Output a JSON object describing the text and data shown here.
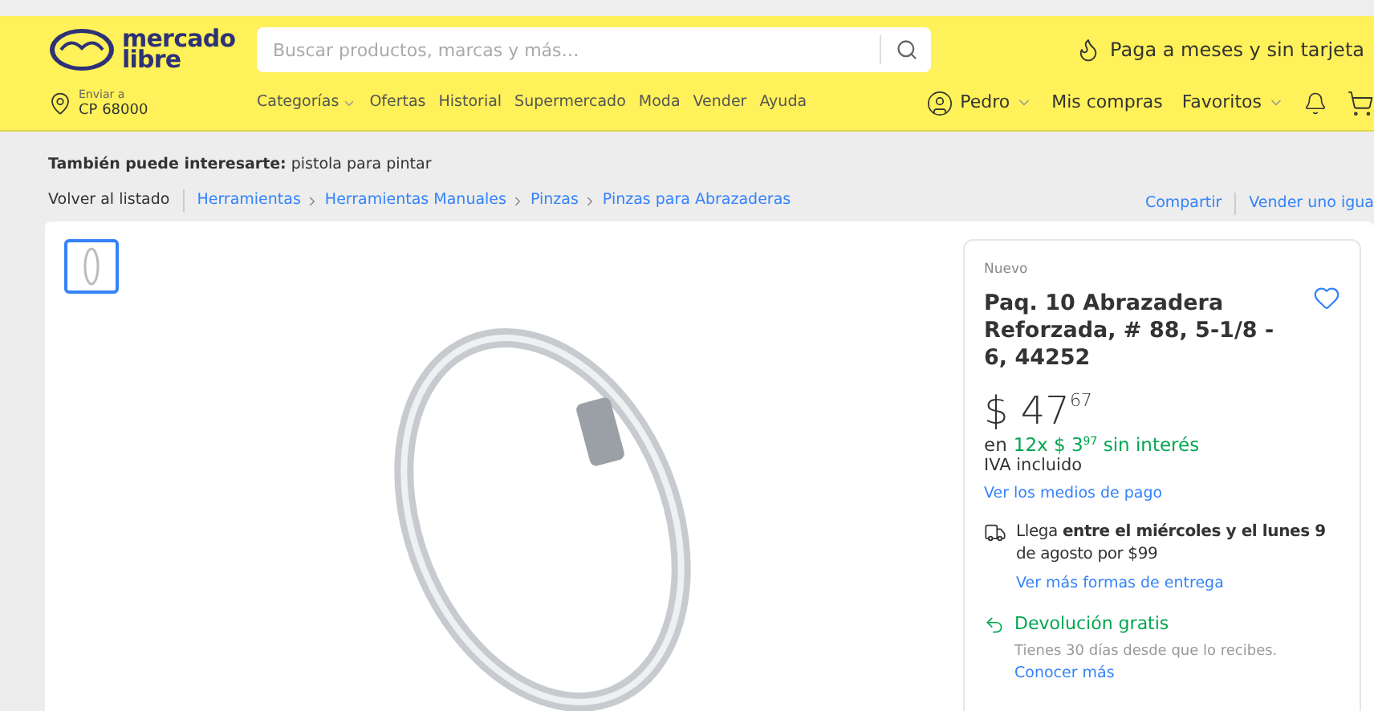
{
  "header": {
    "logo_text": [
      "mercado",
      "libre"
    ],
    "search": {
      "placeholder": "Buscar productos, marcas y más…"
    },
    "promo": "Paga a meses y sin tarjeta",
    "location": {
      "label": "Enviar a",
      "value": "CP 68000"
    },
    "nav": [
      {
        "label": "Categorías",
        "dropdown": true
      },
      {
        "label": "Ofertas",
        "dropdown": false
      },
      {
        "label": "Historial",
        "dropdown": false
      },
      {
        "label": "Supermercado",
        "dropdown": false
      },
      {
        "label": "Moda",
        "dropdown": false
      },
      {
        "label": "Vender",
        "dropdown": false
      },
      {
        "label": "Ayuda",
        "dropdown": false
      }
    ],
    "user_nav": [
      {
        "kind": "user",
        "label": "Pedro",
        "dropdown": true
      },
      {
        "kind": "link",
        "label": "Mis compras",
        "dropdown": false
      },
      {
        "kind": "link",
        "label": "Favoritos",
        "dropdown": true
      },
      {
        "kind": "bell"
      },
      {
        "kind": "cart"
      }
    ]
  },
  "suggestion": "**También puede interesarte:** pistola para pintar",
  "breadcrumb": {
    "back": "Volver al listado",
    "items": [
      "Herramientas",
      "Herramientas Manuales",
      "Pinzas",
      "Pinzas para Abrazaderas"
    ],
    "actions": [
      "Compartir",
      "Vender uno igua"
    ]
  },
  "thumbnails": [
    {
      "selected": true
    }
  ],
  "product": {
    "condition": "Nuevo",
    "title": "Paq. 10 Abrazadera Reforzada, # 88, 5-1/8 - 6, 44252",
    "favorite": false,
    "price": "$ 47$^{67}$",
    "installments_prefix": "en",
    "installments": "12x $ 3$^{97}$ sin interés",
    "tax": "IVA incluido",
    "payment_link": "Ver los medios de pago",
    "shipping": {
      "text": "Llega **entre el miércoles y el lunes 9** de agosto por $99",
      "link": "Ver más formas de entrega"
    },
    "returns": {
      "title": "Devolución gratis",
      "text": "Tienes 30 días desde que lo recibes.",
      "link": "Conocer más"
    }
  }
}
